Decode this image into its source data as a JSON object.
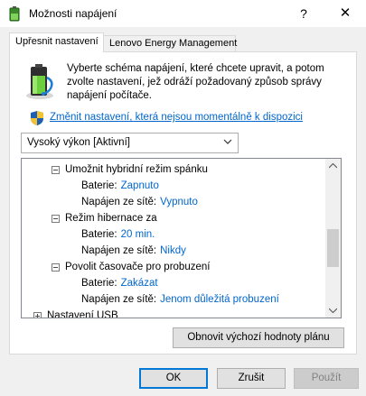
{
  "window": {
    "title": "Možnosti napájení",
    "help_glyph": "?",
    "close_glyph": "✕"
  },
  "tabs": [
    {
      "label": "Upřesnit nastavení",
      "active": true
    },
    {
      "label": "Lenovo Energy Management",
      "active": false
    }
  ],
  "description": "Vyberte schéma napájení, které chcete upravit, a potom zvolte nastavení, jež odráží požadovaný způsob správy napájení počítače.",
  "change_link": "Změnit nastavení, která nejsou momentálně k dispozici",
  "plan_select": {
    "value": "Vysoký výkon [Aktivní]"
  },
  "tree": {
    "items": [
      {
        "label": "Umožnit hybridní režim spánku",
        "expanded": true
      },
      {
        "label": "Baterie:",
        "value": "Zapnuto"
      },
      {
        "label": "Napájen ze sítě:",
        "value": "Vypnuto"
      },
      {
        "label": "Režim hibernace za",
        "expanded": true
      },
      {
        "label": "Baterie:",
        "value": "20 min."
      },
      {
        "label": "Napájen ze sítě:",
        "value": "Nikdy"
      },
      {
        "label": "Povolit časovače pro probuzení",
        "expanded": true
      },
      {
        "label": "Baterie:",
        "value": "Zakázat"
      },
      {
        "label": "Napájen ze sítě:",
        "value": "Jenom důležitá probuzení"
      },
      {
        "label": "Nastavení USB",
        "expanded": false
      }
    ]
  },
  "buttons": {
    "restore": "Obnovit výchozí hodnoty plánu",
    "ok": "OK",
    "cancel": "Zrušit",
    "apply": "Použít"
  },
  "colors": {
    "link": "#0066cc",
    "accent": "#0078d7",
    "disabled_text": "#838383"
  }
}
